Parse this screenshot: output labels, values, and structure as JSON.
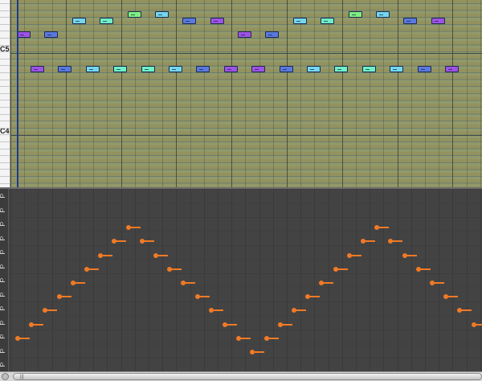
{
  "piano_roll": {
    "octave_labels": [
      "C5",
      "C4"
    ],
    "note_rows": [
      {
        "name": "row-1",
        "color": "#7ef081"
      },
      {
        "name": "row-2",
        "color": "#74d7ee"
      }
    ],
    "notes_upper_phrase": [
      {
        "velocity_color": "purple",
        "pitch_row": 4
      },
      {
        "velocity_color": "blue",
        "pitch_row": 4
      },
      {
        "velocity_color": "cyan",
        "pitch_row": 2
      },
      {
        "velocity_color": "teal",
        "pitch_row": 2
      },
      {
        "velocity_color": "green",
        "pitch_row": 1
      },
      {
        "velocity_color": "cyan",
        "pitch_row": 1
      },
      {
        "velocity_color": "blue",
        "pitch_row": 2
      },
      {
        "velocity_color": "purple",
        "pitch_row": 2
      }
    ],
    "repeating_pattern_colors": [
      "purple",
      "blue",
      "cyan",
      "teal",
      "teal",
      "cyan",
      "blue",
      "purple"
    ]
  },
  "controller_lane": {
    "ruler_digit": "0",
    "velocity_levels": [
      1,
      2,
      3,
      4,
      5,
      6,
      7,
      8,
      9,
      8,
      7,
      6,
      5,
      4,
      3,
      2,
      1,
      0,
      1,
      2,
      3,
      4,
      5,
      6,
      7,
      8,
      9,
      8,
      7,
      6,
      5,
      4,
      3,
      2,
      1
    ],
    "curve_color": "#f07a26"
  },
  "scrollbar": {
    "grip_label": "|||"
  },
  "colors": {
    "purple": "#9f52e6",
    "blue": "#5a79e0",
    "cyan": "#74d7ee",
    "teal": "#6ef0c8",
    "green": "#7ef081",
    "playhead": "#1f3a8a"
  }
}
